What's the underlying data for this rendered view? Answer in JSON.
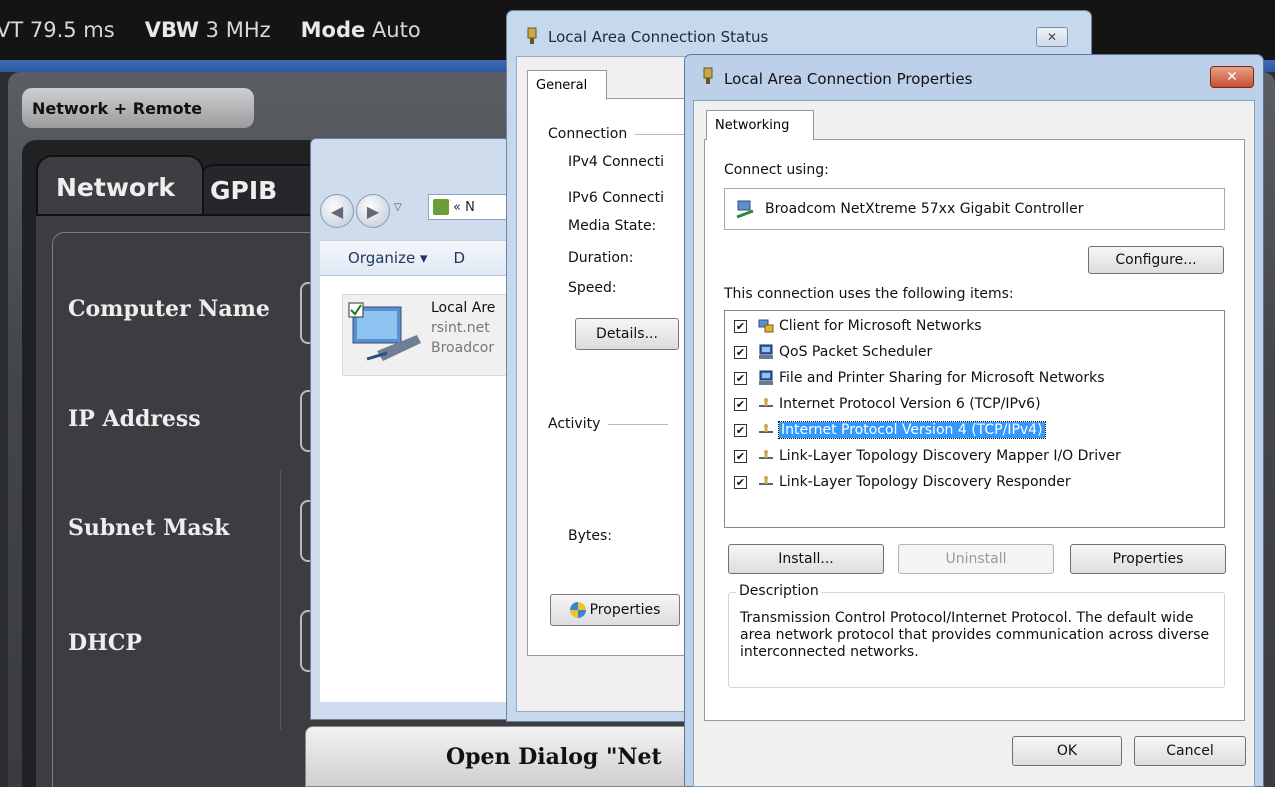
{
  "analyzer": {
    "status_bar": [
      {
        "label": "",
        "value": "VT 79.5 ms"
      },
      {
        "label": "VBW",
        "value": "3 MHz"
      },
      {
        "label": "Mode",
        "value": "Auto"
      }
    ],
    "panel_title": "Network + Remote",
    "tabs": [
      "Network",
      "GPIB"
    ],
    "fields": [
      "Computer Name",
      "IP Address",
      "Subnet Mask",
      "DHCP"
    ],
    "open_dialog_button": "Open Dialog \"Net"
  },
  "explorer": {
    "address_text": "«  N",
    "toolbar": {
      "organize": "Organize ▾",
      "next": "D"
    },
    "connection": {
      "name": "Local Are",
      "domain": "rsint.net",
      "device": "Broadcor"
    }
  },
  "status_dialog": {
    "title": "Local Area Connection Status",
    "close_glyph": "✕",
    "tab": "General",
    "connection_group": "Connection",
    "rows": [
      "IPv4 Connecti",
      "IPv6 Connecti",
      "Media State:",
      "Duration:",
      "Speed:"
    ],
    "details_button": "Details...",
    "activity_group": "Activity",
    "bytes_label": "Bytes:",
    "properties_button": "Properties"
  },
  "properties_dialog": {
    "title": "Local Area Connection Properties",
    "close_glyph": "✕",
    "tab": "Networking",
    "connect_using_label": "Connect using:",
    "adapter": "Broadcom NetXtreme 57xx Gigabit Controller",
    "configure_button": "Configure...",
    "items_label": "This connection uses the following items:",
    "items": [
      {
        "label": "Client for Microsoft Networks",
        "checked": true,
        "icon": "network-client-icon",
        "selected": false
      },
      {
        "label": "QoS Packet Scheduler",
        "checked": true,
        "icon": "computer-service-icon",
        "selected": false
      },
      {
        "label": "File and Printer Sharing for Microsoft Networks",
        "checked": true,
        "icon": "computer-service-icon",
        "selected": false
      },
      {
        "label": "Internet Protocol Version 6 (TCP/IPv6)",
        "checked": true,
        "icon": "protocol-icon",
        "selected": false
      },
      {
        "label": "Internet Protocol Version 4 (TCP/IPv4)",
        "checked": true,
        "icon": "protocol-icon",
        "selected": true
      },
      {
        "label": "Link-Layer Topology Discovery Mapper I/O Driver",
        "checked": true,
        "icon": "protocol-icon",
        "selected": false
      },
      {
        "label": "Link-Layer Topology Discovery Responder",
        "checked": true,
        "icon": "protocol-icon",
        "selected": false
      }
    ],
    "install_button": "Install...",
    "uninstall_button": "Uninstall",
    "properties_button": "Properties",
    "description_label": "Description",
    "description_text": "Transmission Control Protocol/Internet Protocol. The default wide area network protocol that provides communication across diverse interconnected networks.",
    "ok_button": "OK",
    "cancel_button": "Cancel"
  },
  "colors": {
    "selection": "#3399ff",
    "title_bar_blue": "#bcd0ea",
    "close_red": "#c64f2f",
    "analyzer_blue": "#2b58a3"
  }
}
